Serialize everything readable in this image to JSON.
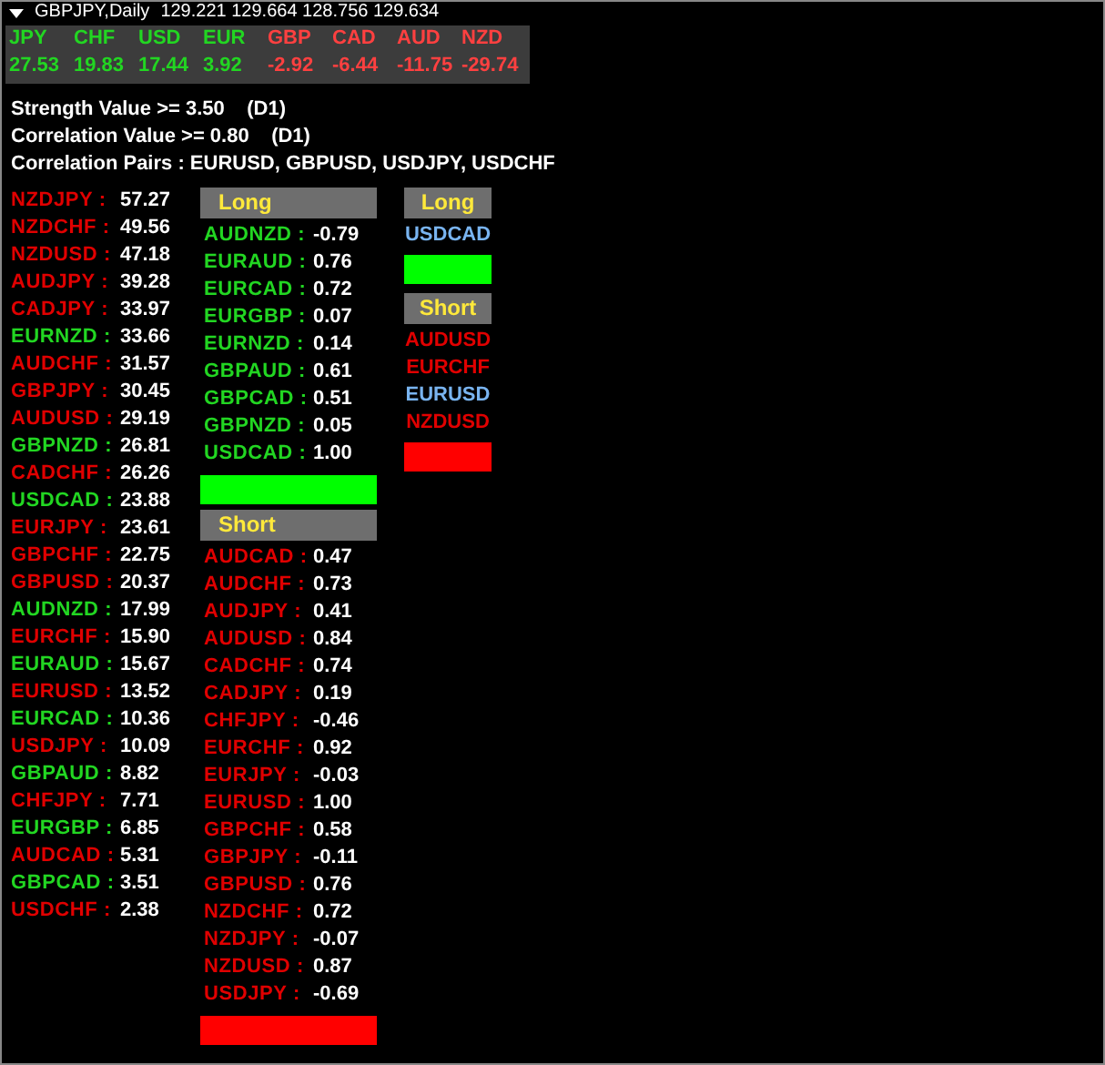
{
  "chart_header": {
    "symbol": "GBPJPY,Daily",
    "prices": "129.221 129.664 128.756 129.634"
  },
  "currencies": [
    {
      "code": "JPY",
      "value": "27.53",
      "color": "#22d622"
    },
    {
      "code": "CHF",
      "value": "19.83",
      "color": "#22d622"
    },
    {
      "code": "USD",
      "value": "17.44",
      "color": "#22d622"
    },
    {
      "code": "EUR",
      "value": "3.92",
      "color": "#22d622"
    },
    {
      "code": "GBP",
      "value": "-2.92",
      "color": "#ff4040"
    },
    {
      "code": "CAD",
      "value": "-6.44",
      "color": "#ff4040"
    },
    {
      "code": "AUD",
      "value": "-11.75",
      "color": "#ff4040"
    },
    {
      "code": "NZD",
      "value": "-29.74",
      "color": "#ff4040"
    }
  ],
  "info_lines": [
    "Strength Value >= 3.50    (D1)",
    "Correlation Value >= 0.80    (D1)",
    "Correlation Pairs : EURUSD, GBPUSD, USDJPY, USDCHF"
  ],
  "strength_list": [
    {
      "pair": "NZDJPY :",
      "value": "57.27",
      "color": "#e00000"
    },
    {
      "pair": "NZDCHF :",
      "value": "49.56",
      "color": "#e00000"
    },
    {
      "pair": "NZDUSD :",
      "value": "47.18",
      "color": "#e00000"
    },
    {
      "pair": "AUDJPY :",
      "value": "39.28",
      "color": "#e00000"
    },
    {
      "pair": "CADJPY :",
      "value": "33.97",
      "color": "#e00000"
    },
    {
      "pair": "EURNZD :",
      "value": "33.66",
      "color": "#22d622"
    },
    {
      "pair": "AUDCHF :",
      "value": "31.57",
      "color": "#e00000"
    },
    {
      "pair": "GBPJPY :",
      "value": "30.45",
      "color": "#e00000"
    },
    {
      "pair": "AUDUSD :",
      "value": "29.19",
      "color": "#e00000"
    },
    {
      "pair": "GBPNZD :",
      "value": "26.81",
      "color": "#22d622"
    },
    {
      "pair": "CADCHF :",
      "value": "26.26",
      "color": "#e00000"
    },
    {
      "pair": "USDCAD :",
      "value": "23.88",
      "color": "#22d622"
    },
    {
      "pair": "EURJPY :",
      "value": "23.61",
      "color": "#e00000"
    },
    {
      "pair": "GBPCHF :",
      "value": "22.75",
      "color": "#e00000"
    },
    {
      "pair": "GBPUSD :",
      "value": "20.37",
      "color": "#e00000"
    },
    {
      "pair": "AUDNZD :",
      "value": "17.99",
      "color": "#22d622"
    },
    {
      "pair": "EURCHF :",
      "value": "15.90",
      "color": "#e00000"
    },
    {
      "pair": "EURAUD :",
      "value": "15.67",
      "color": "#22d622"
    },
    {
      "pair": "EURUSD :",
      "value": "13.52",
      "color": "#e00000"
    },
    {
      "pair": "EURCAD :",
      "value": "10.36",
      "color": "#22d622"
    },
    {
      "pair": "USDJPY :",
      "value": "10.09",
      "color": "#e00000"
    },
    {
      "pair": "GBPAUD :",
      "value": "8.82",
      "color": "#22d622"
    },
    {
      "pair": "CHFJPY :",
      "value": "7.71",
      "color": "#e00000"
    },
    {
      "pair": "EURGBP :",
      "value": "6.85",
      "color": "#22d622"
    },
    {
      "pair": "AUDCAD :",
      "value": "5.31",
      "color": "#e00000"
    },
    {
      "pair": "GBPCAD :",
      "value": "3.51",
      "color": "#22d622"
    },
    {
      "pair": "USDCHF :",
      "value": "2.38",
      "color": "#e00000"
    }
  ],
  "correlation_panels": [
    {
      "title": "Long",
      "color": "#00ff00",
      "rows": [
        {
          "pair": "AUDNZD :",
          "value": "-0.79",
          "color": "#22d622"
        },
        {
          "pair": "EURAUD :",
          "value": "0.76",
          "color": "#22d622"
        },
        {
          "pair": "EURCAD :",
          "value": "0.72",
          "color": "#22d622"
        },
        {
          "pair": "EURGBP :",
          "value": "0.07",
          "color": "#22d622"
        },
        {
          "pair": "EURNZD :",
          "value": "0.14",
          "color": "#22d622"
        },
        {
          "pair": "GBPAUD :",
          "value": "0.61",
          "color": "#22d622"
        },
        {
          "pair": "GBPCAD :",
          "value": "0.51",
          "color": "#22d622"
        },
        {
          "pair": "GBPNZD :",
          "value": "0.05",
          "color": "#22d622"
        },
        {
          "pair": "USDCAD :",
          "value": "1.00",
          "color": "#22d622"
        }
      ]
    },
    {
      "title": "Short",
      "color": "#ff0000",
      "rows": [
        {
          "pair": "AUDCAD :",
          "value": "0.47",
          "color": "#e00000"
        },
        {
          "pair": "AUDCHF :",
          "value": "0.73",
          "color": "#e00000"
        },
        {
          "pair": "AUDJPY :",
          "value": "0.41",
          "color": "#e00000"
        },
        {
          "pair": "AUDUSD :",
          "value": "0.84",
          "color": "#e00000"
        },
        {
          "pair": "CADCHF :",
          "value": "0.74",
          "color": "#e00000"
        },
        {
          "pair": "CADJPY :",
          "value": "0.19",
          "color": "#e00000"
        },
        {
          "pair": "CHFJPY :",
          "value": "-0.46",
          "color": "#e00000"
        },
        {
          "pair": "EURCHF :",
          "value": "0.92",
          "color": "#e00000"
        },
        {
          "pair": "EURJPY :",
          "value": "-0.03",
          "color": "#e00000"
        },
        {
          "pair": "EURUSD :",
          "value": "1.00",
          "color": "#e00000"
        },
        {
          "pair": "GBPCHF :",
          "value": "0.58",
          "color": "#e00000"
        },
        {
          "pair": "GBPJPY :",
          "value": "-0.11",
          "color": "#e00000"
        },
        {
          "pair": "GBPUSD :",
          "value": "0.76",
          "color": "#e00000"
        },
        {
          "pair": "NZDCHF :",
          "value": "0.72",
          "color": "#e00000"
        },
        {
          "pair": "NZDJPY :",
          "value": "-0.07",
          "color": "#e00000"
        },
        {
          "pair": "NZDUSD :",
          "value": "0.87",
          "color": "#e00000"
        },
        {
          "pair": "USDJPY :",
          "value": "-0.69",
          "color": "#e00000"
        }
      ]
    }
  ],
  "signal_panels": [
    {
      "title": "Long",
      "color": "#00ff00",
      "pairs": [
        {
          "name": "USDCAD",
          "color": "#79b4f0"
        }
      ]
    },
    {
      "title": "Short",
      "color": "#ff0000",
      "pairs": [
        {
          "name": "AUDUSD",
          "color": "#e00000"
        },
        {
          "name": "EURCHF",
          "color": "#e00000"
        },
        {
          "name": "EURUSD",
          "color": "#79b4f0"
        },
        {
          "name": "NZDUSD",
          "color": "#e00000"
        }
      ]
    }
  ]
}
